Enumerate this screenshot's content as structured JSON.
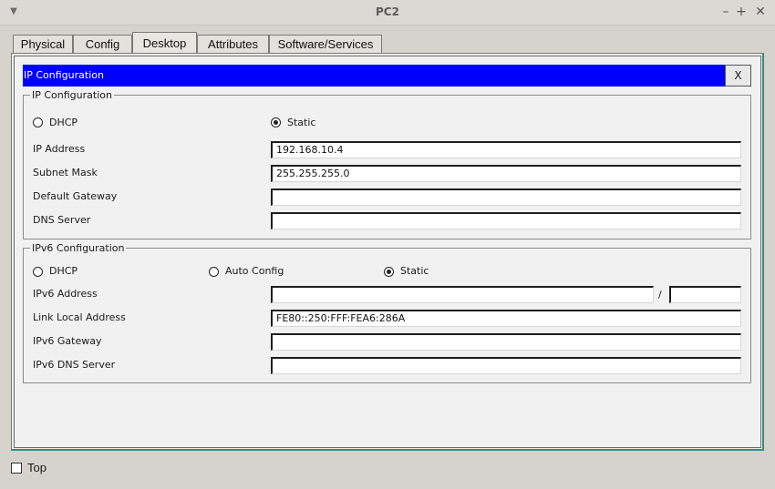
{
  "window": {
    "title": "PC2"
  },
  "tabs": [
    {
      "label": "Physical"
    },
    {
      "label": "Config"
    },
    {
      "label": "Desktop",
      "active": true
    },
    {
      "label": "Attributes"
    },
    {
      "label": "Software/Services"
    }
  ],
  "panel": {
    "title": "IP Configuration",
    "close_label": "X"
  },
  "ipv4": {
    "legend": "IP Configuration",
    "dhcp_label": "DHCP",
    "static_label": "Static",
    "selected": "Static",
    "ip_label": "IP Address",
    "ip_value": "192.168.10.4",
    "mask_label": "Subnet Mask",
    "mask_value": "255.255.255.0",
    "gateway_label": "Default Gateway",
    "gateway_value": "",
    "dns_label": "DNS Server",
    "dns_value": ""
  },
  "ipv6": {
    "legend": "IPv6 Configuration",
    "dhcp_label": "DHCP",
    "auto_label": "Auto Config",
    "static_label": "Static",
    "selected": "Static",
    "addr_label": "IPv6 Address",
    "addr_value": "",
    "slash": "/",
    "prefix_value": "",
    "link_local_label": "Link Local Address",
    "link_local_value": "FE80::250:FFF:FEA6:286A",
    "gateway_label": "IPv6 Gateway",
    "gateway_value": "",
    "dns_label": "IPv6 DNS Server",
    "dns_value": ""
  },
  "footer": {
    "top_label": "Top",
    "top_checked": false
  },
  "colors": {
    "header_blue": "#0000ff",
    "accent_teal": "#2e8f86"
  }
}
